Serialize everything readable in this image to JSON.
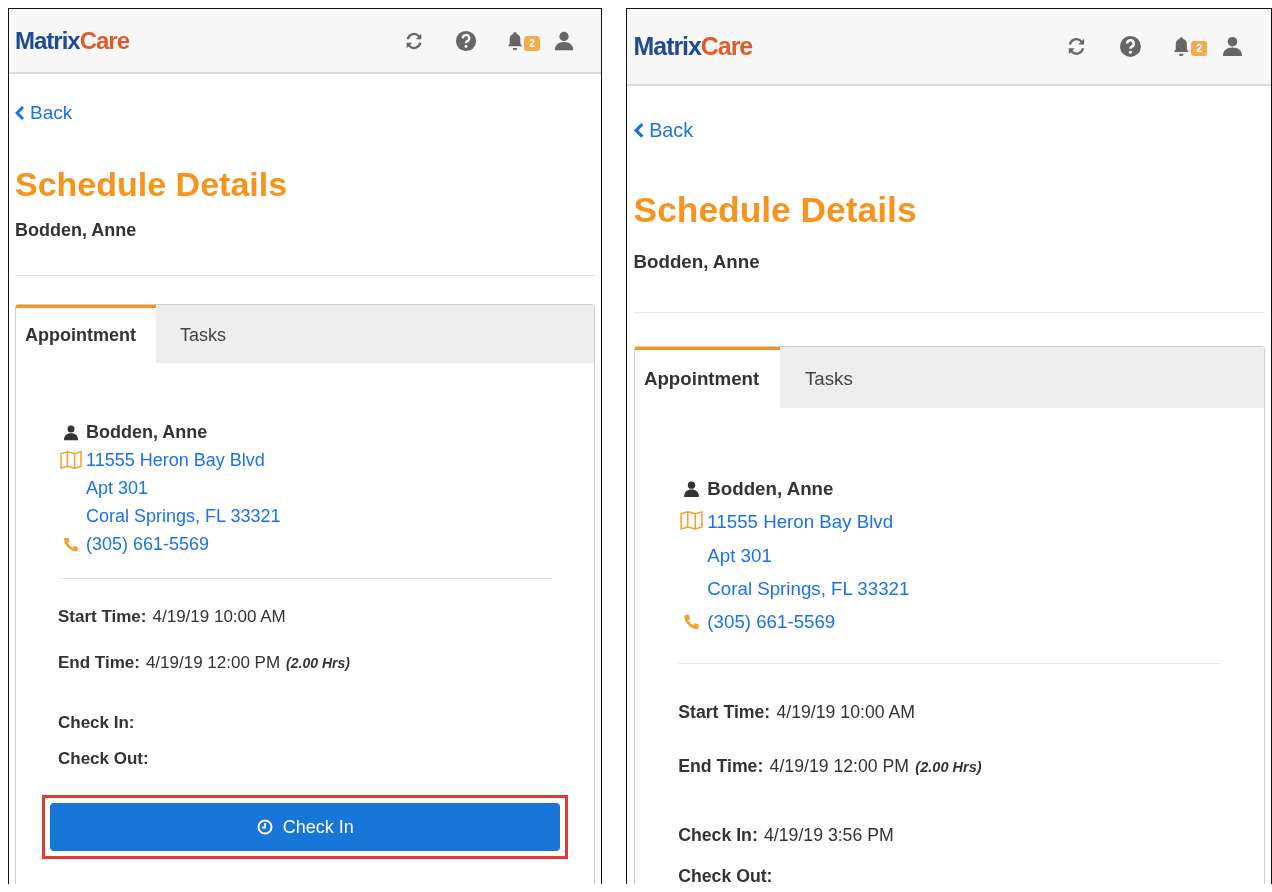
{
  "screens": [
    {
      "header": {
        "logo_first": "Matrix",
        "logo_second": "Care",
        "notification_count": "2"
      },
      "back": "Back",
      "title": "Schedule Details",
      "client": "Bodden, Anne",
      "tabs": [
        {
          "label": "Appointment",
          "selected": true
        },
        {
          "label": "Tasks",
          "selected": false
        }
      ],
      "patient": {
        "name": "Bodden, Anne",
        "address": [
          "11555 Heron Bay Blvd",
          "Apt 301",
          "Coral Springs, FL 33321"
        ],
        "phone": "(305) 661-5569"
      },
      "schedule_times": [
        {
          "label": "Start Time:",
          "value": "4/19/19 10:00 AM"
        },
        {
          "label": "End Time:",
          "value": "4/19/19 12:00 PM",
          "note": "(2.00 Hrs)"
        }
      ],
      "visit_times": [
        {
          "label": "Check In:"
        },
        {
          "label": "Check Out:"
        }
      ],
      "button": {
        "label": "Check In",
        "highlighted": true
      }
    },
    {
      "header": {
        "logo_first": "Matrix",
        "logo_second": "Care",
        "notification_count": "2"
      },
      "back": "Back",
      "title": "Schedule Details",
      "client": "Bodden, Anne",
      "tabs": [
        {
          "label": "Appointment",
          "selected": true
        },
        {
          "label": "Tasks",
          "selected": false
        }
      ],
      "patient": {
        "name": "Bodden, Anne",
        "address": [
          "11555 Heron Bay Blvd",
          "Apt 301",
          "Coral Springs, FL 33321"
        ],
        "phone": "(305) 661-5569"
      },
      "schedule_times": [
        {
          "label": "Start Time:",
          "value": "4/19/19 10:00 AM"
        },
        {
          "label": "End Time:",
          "value": "4/19/19 12:00 PM",
          "note": "(2.00 Hrs)"
        }
      ],
      "visit_times": [
        {
          "label": "Check In:",
          "value": "4/19/19 3:56 PM"
        },
        {
          "label": "Check Out:"
        }
      ]
    }
  ]
}
